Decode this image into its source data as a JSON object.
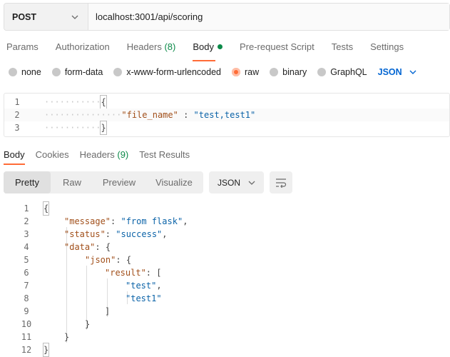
{
  "request": {
    "method": "POST",
    "url": "localhost:3001/api/scoring"
  },
  "request_tabs": [
    {
      "label": "Params"
    },
    {
      "label": "Authorization"
    },
    {
      "label": "Headers",
      "count": "(8)"
    },
    {
      "label": "Body",
      "active": true
    },
    {
      "label": "Pre-request Script"
    },
    {
      "label": "Tests"
    },
    {
      "label": "Settings"
    }
  ],
  "body_types": [
    {
      "label": "none"
    },
    {
      "label": "form-data"
    },
    {
      "label": "x-www-form-urlencoded"
    },
    {
      "label": "raw",
      "selected": true
    },
    {
      "label": "binary"
    },
    {
      "label": "GraphQL"
    }
  ],
  "body_format": "JSON",
  "request_body": {
    "lines": [
      {
        "n": "1",
        "text": "{"
      },
      {
        "n": "2",
        "key": "\"file_name\"",
        "sep": " : ",
        "value": "\"test,test1\""
      },
      {
        "n": "3",
        "text": "}"
      }
    ]
  },
  "response_tabs": [
    {
      "label": "Body",
      "active": true
    },
    {
      "label": "Cookies"
    },
    {
      "label": "Headers",
      "count": "(9)"
    },
    {
      "label": "Test Results"
    }
  ],
  "response_views": [
    "Pretty",
    "Raw",
    "Preview",
    "Visualize"
  ],
  "response_format": "JSON",
  "response_body": {
    "line_numbers": [
      "1",
      "2",
      "3",
      "4",
      "5",
      "6",
      "7",
      "8",
      "9",
      "10",
      "11",
      "12"
    ],
    "lines": [
      {
        "punc": "{"
      },
      {
        "key": "\"message\"",
        "sep": ": ",
        "value": "\"from flask\"",
        "tail": ","
      },
      {
        "key": "\"status\"",
        "sep": ": ",
        "value": "\"success\"",
        "tail": ","
      },
      {
        "key": "\"data\"",
        "sep": ": ",
        "tail": "{"
      },
      {
        "key": "\"json\"",
        "sep": ": ",
        "tail": "{"
      },
      {
        "key": "\"result\"",
        "sep": ": ",
        "tail": "["
      },
      {
        "value": "\"test\"",
        "tail": ","
      },
      {
        "value": "\"test1\""
      },
      {
        "punc": "]"
      },
      {
        "punc": "}"
      },
      {
        "punc": "}"
      },
      {
        "punc": "}"
      }
    ]
  },
  "colors": {
    "accent": "#ff6c37",
    "green": "#0c8a49",
    "link_blue": "#0265d2",
    "json_key": "#a14f1a",
    "json_string": "#0b63a8"
  },
  "icons": [
    "chevron-down-icon",
    "wrap-lines-icon"
  ]
}
